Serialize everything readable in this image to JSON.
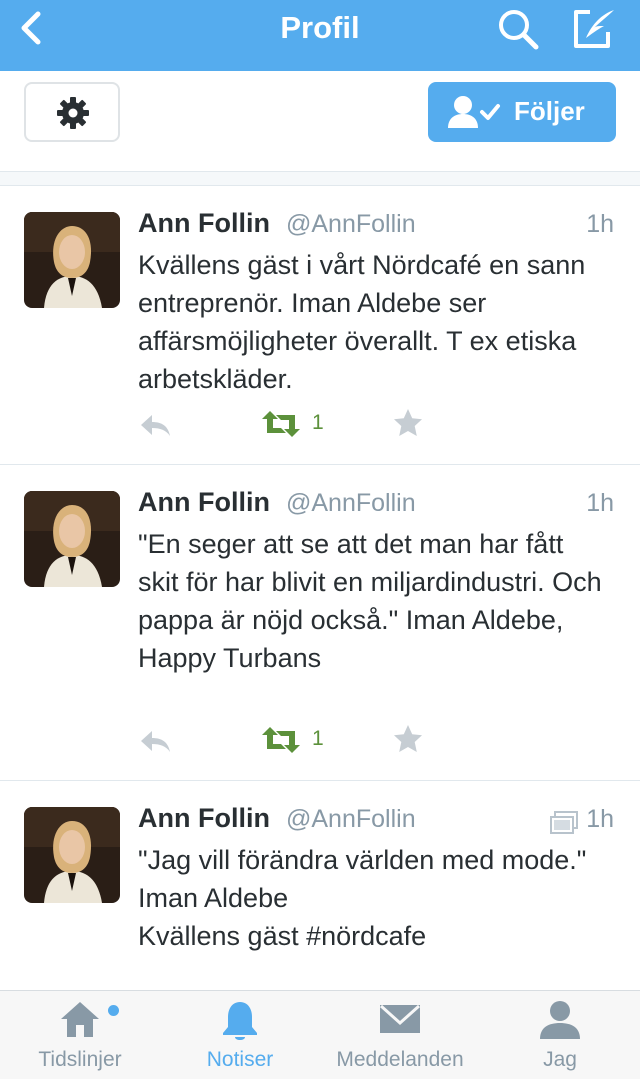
{
  "navbar": {
    "title": "Profil",
    "back_icon": "chevron-left-icon",
    "search_icon": "search-icon",
    "compose_icon": "compose-icon"
  },
  "profile_actions": {
    "settings_icon": "gear-icon",
    "follow_label": "Följer",
    "follow_icon": "user-check-icon"
  },
  "tweets": [
    {
      "name": "Ann Follin",
      "handle": "@AnnFollin",
      "time": "1h",
      "text": "Kvällens gäst i vårt Nördcafé en sann entreprenör. Iman Aldebe ser affärsmöjligheter överallt. T ex etiska arbetskläder.",
      "retweets": "1"
    },
    {
      "name": "Ann Follin",
      "handle": "@AnnFollin",
      "time": "1h",
      "text": "\"En seger att se att det man har fått skit för har blivit en miljardindustri. Och pappa är nöjd också.\" Iman Aldebe, Happy Turbans",
      "retweets": "1"
    },
    {
      "name": "Ann Follin",
      "handle": "@AnnFollin",
      "time": "1h",
      "text_lines": [
        "\"Jag vill förändra världen med mode.\"",
        "Iman Aldebe",
        "Kvällens gäst #nördcafe"
      ],
      "media_icon": "media-icon"
    }
  ],
  "tabbar": {
    "tabs": [
      {
        "label": "Tidslinjer",
        "icon": "home-icon",
        "active": false
      },
      {
        "label": "Notiser",
        "icon": "bell-icon",
        "active": true
      },
      {
        "label": "Meddelanden",
        "icon": "envelope-icon",
        "active": false
      },
      {
        "label": "Jag",
        "icon": "person-icon",
        "active": false
      }
    ]
  },
  "colors": {
    "brand": "#55acee",
    "retweet_green": "#5c913b",
    "muted": "#8899a6",
    "text": "#292f33"
  }
}
